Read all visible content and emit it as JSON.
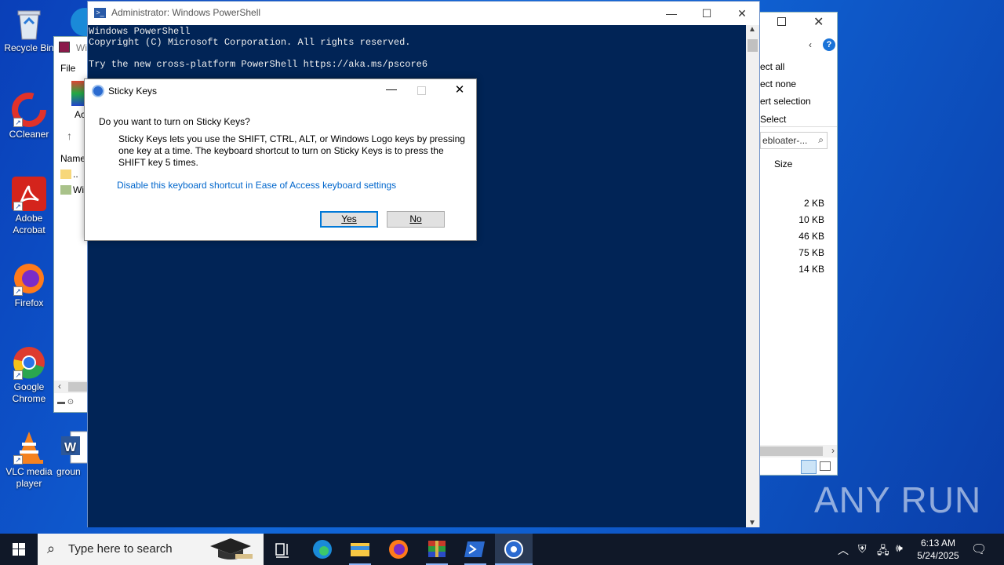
{
  "desktop_icons": [
    {
      "label": "Recycle Bin"
    },
    {
      "label": "CCleaner"
    },
    {
      "label": "Adobe Acrobat"
    },
    {
      "label": "Firefox"
    },
    {
      "label": "Google Chrome"
    },
    {
      "label": "VLC media player"
    },
    {
      "label": "groun"
    }
  ],
  "winrar": {
    "title_fragment": "Wi",
    "menu_file": "File",
    "toolbar_fragment": "Ac",
    "col_name": "Name",
    "rows": [
      "..",
      "Wi"
    ]
  },
  "explorer": {
    "menu": [
      "ect all",
      "ect none",
      "ert selection",
      "Select"
    ],
    "search_placeholder": "ebloater-...",
    "col_size": "Size",
    "sizes": [
      "2 KB",
      "10 KB",
      "46 KB",
      "75 KB",
      "14 KB"
    ]
  },
  "powershell": {
    "title": "Administrator: Windows PowerShell",
    "lines": [
      "Windows PowerShell",
      "Copyright (C) Microsoft Corporation. All rights reserved.",
      "",
      "Try the new cross-platform PowerShell https://aka.ms/pscore6"
    ]
  },
  "dialog": {
    "title": "Sticky Keys",
    "question": "Do you want to turn on Sticky Keys?",
    "description": "Sticky Keys lets you use the SHIFT, CTRL, ALT, or Windows Logo keys by pressing one key at a time. The keyboard shortcut to turn on Sticky Keys is to press the SHIFT key 5 times.",
    "link": "Disable this keyboard shortcut in Ease of Access keyboard settings",
    "yes_label": "Yes",
    "no_label": "No"
  },
  "taskbar": {
    "search_placeholder": "Type here to search",
    "time": "6:13 AM",
    "date": "5/24/2025"
  },
  "watermark": "ANY RUN",
  "colors": {
    "console_bg": "#012456",
    "accent": "#0078d7",
    "link": "#0066cc"
  }
}
